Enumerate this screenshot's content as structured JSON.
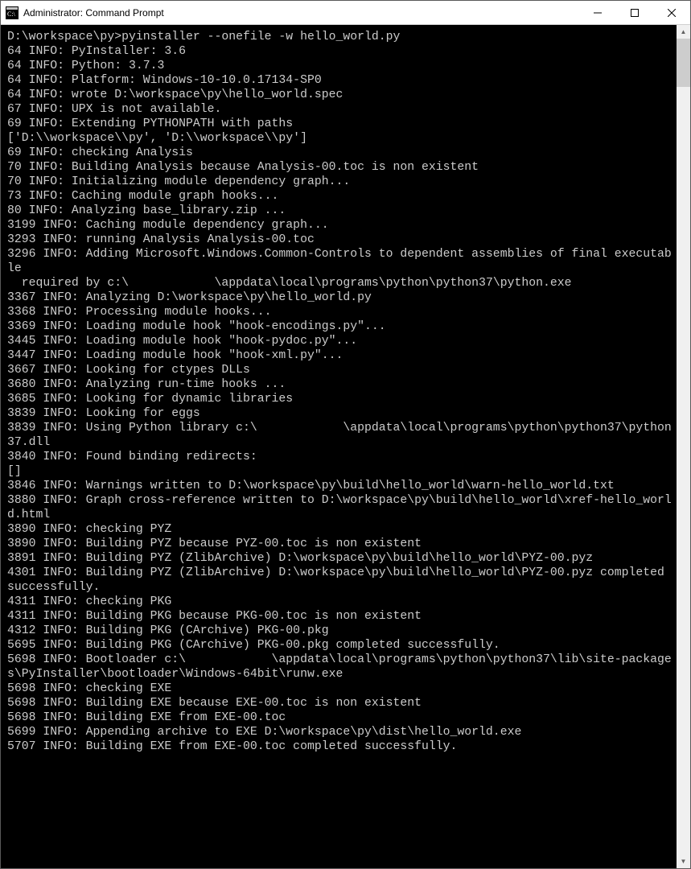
{
  "window": {
    "title": "Administrator: Command Prompt"
  },
  "prompt": "D:\\workspace\\py>",
  "command": "pyinstaller --onefile -w hello_world.py",
  "lines": [
    "64 INFO: PyInstaller: 3.6",
    "64 INFO: Python: 3.7.3",
    "64 INFO: Platform: Windows-10-10.0.17134-SP0",
    "64 INFO: wrote D:\\workspace\\py\\hello_world.spec",
    "67 INFO: UPX is not available.",
    "69 INFO: Extending PYTHONPATH with paths",
    "['D:\\\\workspace\\\\py', 'D:\\\\workspace\\\\py']",
    "69 INFO: checking Analysis",
    "70 INFO: Building Analysis because Analysis-00.toc is non existent",
    "70 INFO: Initializing module dependency graph...",
    "73 INFO: Caching module graph hooks...",
    "80 INFO: Analyzing base_library.zip ...",
    "3199 INFO: Caching module dependency graph...",
    "3293 INFO: running Analysis Analysis-00.toc",
    "3296 INFO: Adding Microsoft.Windows.Common-Controls to dependent assemblies of final executable",
    "  required by c:\\            \\appdata\\local\\programs\\python\\python37\\python.exe",
    "3367 INFO: Analyzing D:\\workspace\\py\\hello_world.py",
    "3368 INFO: Processing module hooks...",
    "3369 INFO: Loading module hook \"hook-encodings.py\"...",
    "3445 INFO: Loading module hook \"hook-pydoc.py\"...",
    "3447 INFO: Loading module hook \"hook-xml.py\"...",
    "3667 INFO: Looking for ctypes DLLs",
    "3680 INFO: Analyzing run-time hooks ...",
    "3685 INFO: Looking for dynamic libraries",
    "3839 INFO: Looking for eggs",
    "3839 INFO: Using Python library c:\\            \\appdata\\local\\programs\\python\\python37\\python37.dll",
    "3840 INFO: Found binding redirects:",
    "[]",
    "3846 INFO: Warnings written to D:\\workspace\\py\\build\\hello_world\\warn-hello_world.txt",
    "3880 INFO: Graph cross-reference written to D:\\workspace\\py\\build\\hello_world\\xref-hello_world.html",
    "3890 INFO: checking PYZ",
    "3890 INFO: Building PYZ because PYZ-00.toc is non existent",
    "3891 INFO: Building PYZ (ZlibArchive) D:\\workspace\\py\\build\\hello_world\\PYZ-00.pyz",
    "4301 INFO: Building PYZ (ZlibArchive) D:\\workspace\\py\\build\\hello_world\\PYZ-00.pyz completed successfully.",
    "4311 INFO: checking PKG",
    "4311 INFO: Building PKG because PKG-00.toc is non existent",
    "4312 INFO: Building PKG (CArchive) PKG-00.pkg",
    "5695 INFO: Building PKG (CArchive) PKG-00.pkg completed successfully.",
    "5698 INFO: Bootloader c:\\            \\appdata\\local\\programs\\python\\python37\\lib\\site-packages\\PyInstaller\\bootloader\\Windows-64bit\\runw.exe",
    "5698 INFO: checking EXE",
    "5698 INFO: Building EXE because EXE-00.toc is non existent",
    "5698 INFO: Building EXE from EXE-00.toc",
    "5699 INFO: Appending archive to EXE D:\\workspace\\py\\dist\\hello_world.exe",
    "5707 INFO: Building EXE from EXE-00.toc completed successfully.",
    ""
  ]
}
